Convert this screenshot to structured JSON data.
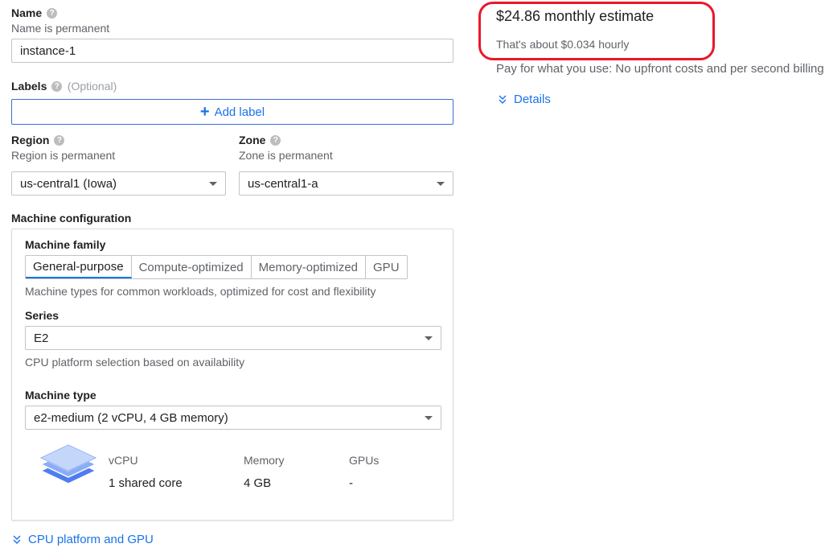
{
  "name_section": {
    "label": "Name",
    "help": "?",
    "sub": "Name is permanent",
    "value": "instance-1"
  },
  "labels_section": {
    "label": "Labels",
    "help": "?",
    "optional": "(Optional)",
    "add_button": "Add label",
    "add_icon": "+"
  },
  "region": {
    "label": "Region",
    "help": "?",
    "sub": "Region is permanent",
    "value": "us-central1 (Iowa)"
  },
  "zone": {
    "label": "Zone",
    "help": "?",
    "sub": "Zone is permanent",
    "value": "us-central1-a"
  },
  "machine_config": {
    "label": "Machine configuration",
    "family_label": "Machine family",
    "tabs": [
      "General-purpose",
      "Compute-optimized",
      "Memory-optimized",
      "GPU"
    ],
    "active_tab": "General-purpose",
    "family_desc": "Machine types for common workloads, optimized for cost and flexibility",
    "series_label": "Series",
    "series_value": "E2",
    "series_desc": "CPU platform selection based on availability",
    "type_label": "Machine type",
    "type_value": "e2-medium (2 vCPU, 4 GB memory)",
    "specs": {
      "vcpu_header": "vCPU",
      "vcpu_value": "1 shared core",
      "memory_header": "Memory",
      "memory_value": "4 GB",
      "gpus_header": "GPUs",
      "gpus_value": "-"
    }
  },
  "cpu_platform_link": "CPU platform and GPU",
  "estimate": {
    "monthly": "$24.86 monthly estimate",
    "hourly": "That's about $0.034 hourly",
    "billing": "Pay for what you use: No upfront costs and per second billing",
    "details": "Details"
  },
  "colors": {
    "accent": "#1a73e8",
    "highlight": "#e8182b",
    "icon_stack": "#4f7df0"
  },
  "icons": {
    "dropdown": "caret-down-icon",
    "help": "help-icon",
    "expand": "chevron-double-down-icon",
    "machine": "layers-icon"
  }
}
